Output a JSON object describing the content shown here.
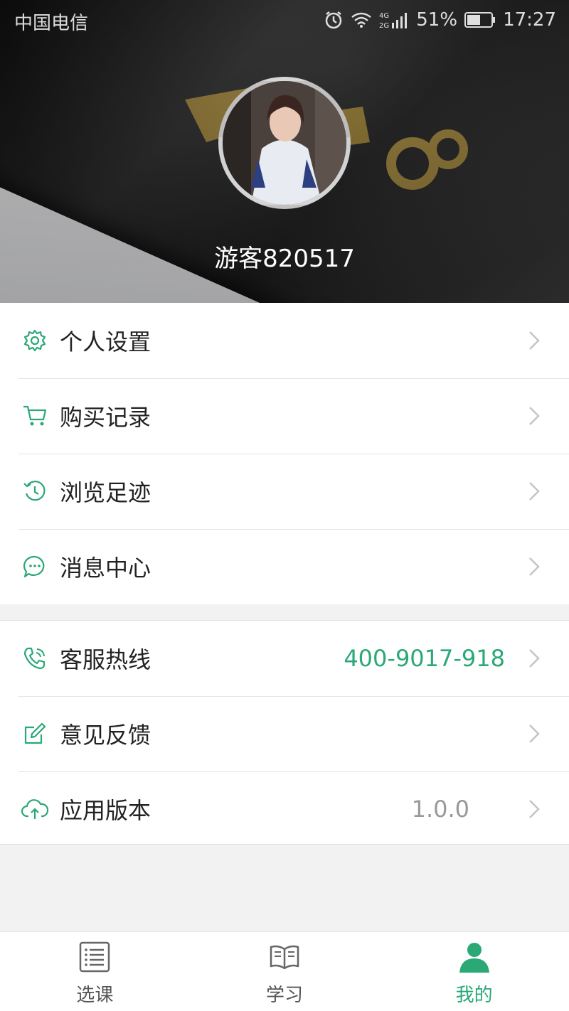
{
  "status_bar": {
    "carrier": "中国电信",
    "network": "4G 2G",
    "battery_percent": "51%",
    "time": "17:27"
  },
  "profile": {
    "username": "游客820517"
  },
  "menu_group_1": [
    {
      "label": "个人设置",
      "icon": "gear-icon"
    },
    {
      "label": "购买记录",
      "icon": "cart-icon"
    },
    {
      "label": "浏览足迹",
      "icon": "history-icon"
    },
    {
      "label": "消息中心",
      "icon": "message-icon"
    }
  ],
  "menu_group_2": [
    {
      "label": "客服热线",
      "icon": "phone-icon",
      "value": "400-9017-918"
    },
    {
      "label": "意见反馈",
      "icon": "edit-icon"
    },
    {
      "label": "应用版本",
      "icon": "cloud-upload-icon",
      "value": "1.0.0"
    }
  ],
  "tabbar": [
    {
      "label": "选课",
      "icon": "list-icon",
      "active": false
    },
    {
      "label": "学习",
      "icon": "book-icon",
      "active": false
    },
    {
      "label": "我的",
      "icon": "user-icon",
      "active": true
    }
  ],
  "colors": {
    "accent": "#2aa876",
    "text": "#222222",
    "muted": "#999999",
    "background": "#f2f2f2"
  }
}
